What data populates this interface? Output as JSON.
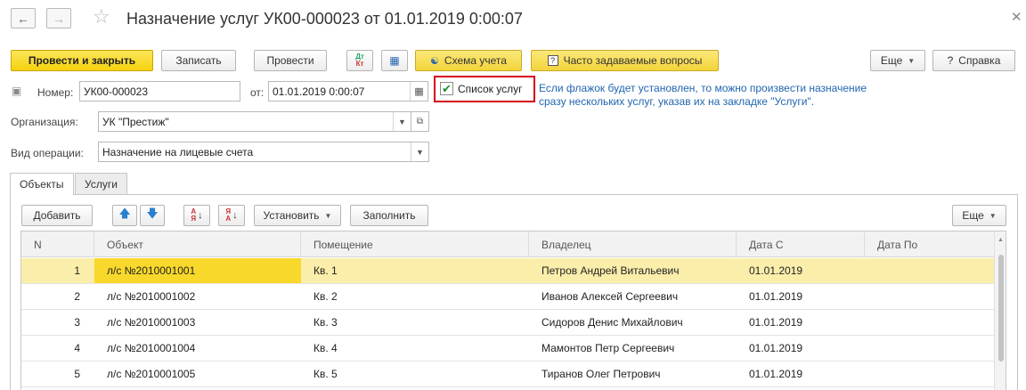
{
  "window": {
    "title": "Назначение услуг УК00-000023 от 01.01.2019 0:00:07"
  },
  "toolbar": {
    "post_close": "Провести и закрыть",
    "write": "Записать",
    "post": "Провести",
    "dtkt": "Дт Кт",
    "scheme": "Схема учета",
    "faq": "Часто задаваемые вопросы",
    "more": "Еще",
    "help": "Справка"
  },
  "form": {
    "number_label": "Номер:",
    "number": "УК00-000023",
    "date_label": "от:",
    "date": "01.01.2019  0:00:07",
    "services_list_label": "Список услуг",
    "services_list_checked": true,
    "hint_line1": "Если флажок будет установлен, то можно произвести назначение",
    "hint_line2": "сразу нескольких услуг, указав их на закладке \"Услуги\".",
    "org_label": "Организация:",
    "org": "УК \"Престиж\"",
    "op_label": "Вид операции:",
    "op": "Назначение на лицевые счета"
  },
  "tabs": [
    {
      "label": "Объекты",
      "active": true
    },
    {
      "label": "Услуги",
      "active": false
    }
  ],
  "table_toolbar": {
    "add": "Добавить",
    "set": "Установить",
    "fill": "Заполнить",
    "more": "Еще"
  },
  "table": {
    "columns": [
      "N",
      "Объект",
      "Помещение",
      "Владелец",
      "Дата С",
      "Дата По"
    ],
    "rows": [
      {
        "n": "1",
        "object": "л/с №2010001001",
        "room": "Кв. 1",
        "owner": "Петров Андрей Витальевич",
        "date_from": "01.01.2019",
        "date_to": ""
      },
      {
        "n": "2",
        "object": "л/с №2010001002",
        "room": "Кв. 2",
        "owner": "Иванов Алексей Сергеевич",
        "date_from": "01.01.2019",
        "date_to": ""
      },
      {
        "n": "3",
        "object": "л/с №2010001003",
        "room": "Кв. 3",
        "owner": "Сидоров Денис Михайлович",
        "date_from": "01.01.2019",
        "date_to": ""
      },
      {
        "n": "4",
        "object": "л/с №2010001004",
        "room": "Кв. 4",
        "owner": "Мамонтов Петр Сергеевич",
        "date_from": "01.01.2019",
        "date_to": ""
      },
      {
        "n": "5",
        "object": "л/с №2010001005",
        "room": "Кв. 5",
        "owner": "Тиранов Олег Петрович",
        "date_from": "01.01.2019",
        "date_to": ""
      }
    ],
    "selected_row": 0
  }
}
